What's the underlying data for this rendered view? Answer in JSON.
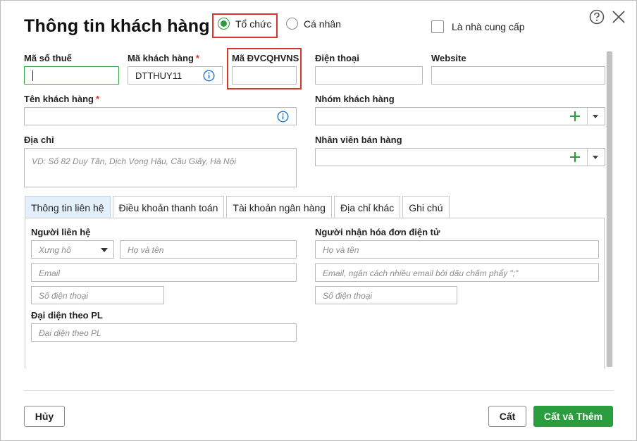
{
  "dialog": {
    "title": "Thông tin khách hàng",
    "type_options": [
      {
        "label": "Tổ chức",
        "checked": true
      },
      {
        "label": "Cá nhân",
        "checked": false
      }
    ],
    "supplier_checkbox": {
      "label": "Là nhà cung cấp",
      "checked": false
    },
    "help_icon": "question-circle-icon",
    "close_icon": "close-icon"
  },
  "fields": {
    "tax_code": {
      "label": "Mã số thuế",
      "value": ""
    },
    "customer_code": {
      "label": "Mã khách hàng",
      "required_mark": "*",
      "value": "DTTHUY11"
    },
    "budget_unit_code": {
      "label": "Mã ĐVCQHVNS",
      "value": ""
    },
    "phone": {
      "label": "Điện thoại",
      "value": ""
    },
    "website": {
      "label": "Website",
      "value": ""
    },
    "customer_name": {
      "label": "Tên khách hàng",
      "required_mark": "*",
      "value": ""
    },
    "customer_group": {
      "label": "Nhóm khách hàng",
      "value": ""
    },
    "address": {
      "label": "Địa chỉ",
      "placeholder": "VD: Số 82 Duy Tân, Dịch Vọng Hậu, Cầu Giấy, Hà Nội"
    },
    "sales_staff": {
      "label": "Nhân viên bán hàng",
      "value": ""
    }
  },
  "tabs": [
    {
      "label": "Thông tin liên hệ",
      "active": true
    },
    {
      "label": "Điều khoản thanh toán",
      "active": false
    },
    {
      "label": "Tài khoản ngân hàng",
      "active": false
    },
    {
      "label": "Địa chỉ khác",
      "active": false
    },
    {
      "label": "Ghi chú",
      "active": false
    }
  ],
  "contact": {
    "section_label": "Người liên hệ",
    "salutation_placeholder": "Xưng hô",
    "fullname_placeholder": "Họ và tên",
    "email_placeholder": "Email",
    "phone_placeholder": "Số điện thoại",
    "legal_rep_label": "Đại diện theo PL",
    "legal_rep_placeholder": "Đại diện theo PL"
  },
  "einvoice_receiver": {
    "section_label": "Người nhận hóa đơn điện tử",
    "fullname_placeholder": "Họ và tên",
    "email_placeholder": "Email, ngăn cách nhiều email bởi dấu chấm phẩy \";\"",
    "phone_placeholder": "Số điện thoại"
  },
  "footer": {
    "cancel_label": "Hủy",
    "save_label": "Cất",
    "save_add_label": "Cất và Thêm"
  },
  "colors": {
    "accent_green": "#2a9d3e",
    "highlight_red": "#d9362b",
    "info_blue": "#1e7ac8"
  }
}
